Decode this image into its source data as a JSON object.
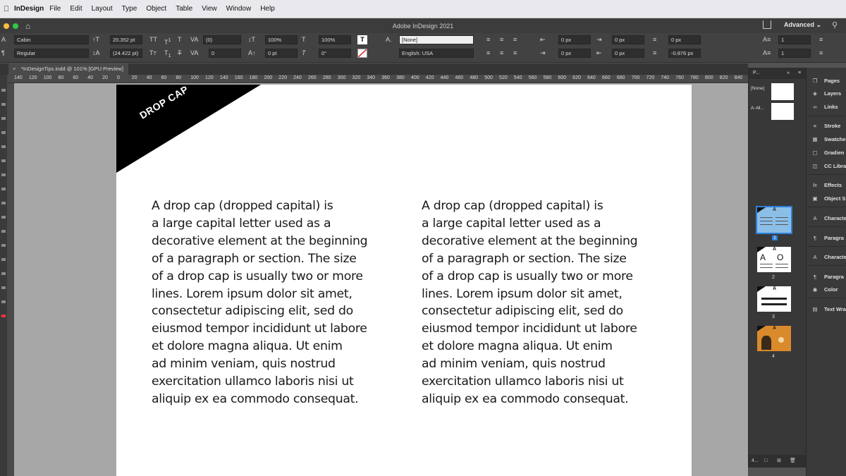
{
  "menubar": {
    "app": "InDesign",
    "items": [
      "File",
      "Edit",
      "Layout",
      "Type",
      "Object",
      "Table",
      "View",
      "Window",
      "Help"
    ]
  },
  "window": {
    "title": "Adobe InDesign 2021",
    "workspace": "Advanced"
  },
  "control": {
    "font_family": "Cabin",
    "font_style": "Regular",
    "font_size": "20.352 pt",
    "leading": "(24.422 pt)",
    "kerning": "(0)",
    "tracking": "0",
    "vscale": "100%",
    "hscale": "100%",
    "baseline": "0 pt",
    "skew": "0°",
    "char_style": "[None]",
    "language": "English: USA",
    "indent_left": "0 px",
    "indent_right": "0 px",
    "indent_first": "0 px",
    "indent_last": "0 px",
    "space_before": "0 px",
    "space_after": "-0.876 px",
    "dropcap_lines": "1",
    "dropcap_chars": "1"
  },
  "document_tab": {
    "label": "*InDesignTips.indd @ 101% [GPU Preview]"
  },
  "ruler": {
    "ticks": [
      "140",
      "120",
      "100",
      "80",
      "60",
      "40",
      "20",
      "0",
      "20",
      "40",
      "60",
      "80",
      "100",
      "120",
      "140",
      "160",
      "180",
      "200",
      "220",
      "240",
      "260",
      "280",
      "300",
      "320",
      "340",
      "360",
      "380",
      "400",
      "420",
      "440",
      "460",
      "480",
      "500",
      "520",
      "540",
      "560",
      "580",
      "600",
      "620",
      "640",
      "660",
      "680",
      "700",
      "720",
      "740",
      "760",
      "780",
      "800",
      "820",
      "840"
    ]
  },
  "page": {
    "banner": "DROP CAP",
    "left_column": [
      "A drop cap (dropped capital) is",
      "a large capital letter used as a",
      "decorative element at the beginning",
      "of a paragraph or section. The size",
      "of a drop cap is usually two or more",
      "lines. Lorem ipsum dolor sit amet,",
      "consectetur adipiscing elit, sed do",
      "eiusmod tempor incididunt ut labore",
      "et dolore magna aliqua. Ut enim",
      "ad minim veniam, quis nostrud",
      "exercitation ullamco laboris nisi ut",
      "aliquip ex ea commodo consequat."
    ],
    "right_column": [
      "A drop cap (dropped capital) is",
      "a large capital letter used as a",
      "decorative element at the beginning",
      "of a paragraph or section. The size",
      "of a drop cap is usually two or more",
      "lines. Lorem ipsum dolor sit amet,",
      "consectetur adipiscing elit, sed do",
      "eiusmod tempor incididunt ut labore",
      "et dolore magna aliqua. Ut enim",
      "ad minim veniam, quis nostrud",
      "exercitation ullamco laboris nisi ut",
      "aliquip ex ea commodo consequat."
    ]
  },
  "pages_panel": {
    "tab": "P...",
    "masters": [
      "[None]",
      "A–M..."
    ],
    "pages": [
      "1",
      "2",
      "3",
      "4"
    ],
    "footer": "4..."
  },
  "dock": {
    "items": [
      {
        "label": "Pages",
        "icon": "pages-icon"
      },
      {
        "label": "Layers",
        "icon": "layers-icon"
      },
      {
        "label": "Links",
        "icon": "links-icon"
      },
      {
        "label": "Stroke",
        "icon": "stroke-icon"
      },
      {
        "label": "Swatche",
        "icon": "swatches-icon"
      },
      {
        "label": "Gradien",
        "icon": "gradient-icon"
      },
      {
        "label": "CC Libra",
        "icon": "cc-libraries-icon"
      },
      {
        "label": "Effects",
        "icon": "effects-icon"
      },
      {
        "label": "Object S",
        "icon": "object-styles-icon"
      },
      {
        "label": "Characte",
        "icon": "character-icon"
      },
      {
        "label": "Paragra",
        "icon": "paragraph-icon"
      },
      {
        "label": "Characte",
        "icon": "character-styles-icon"
      },
      {
        "label": "Paragra",
        "icon": "paragraph-styles-icon"
      },
      {
        "label": "Color",
        "icon": "color-icon"
      },
      {
        "label": "Text Wra",
        "icon": "text-wrap-icon"
      }
    ]
  },
  "colors": {
    "accent": "#2f7fd8",
    "banner": "#000000",
    "page": "#ffffff",
    "pasteboard": "#a7a7a7"
  }
}
